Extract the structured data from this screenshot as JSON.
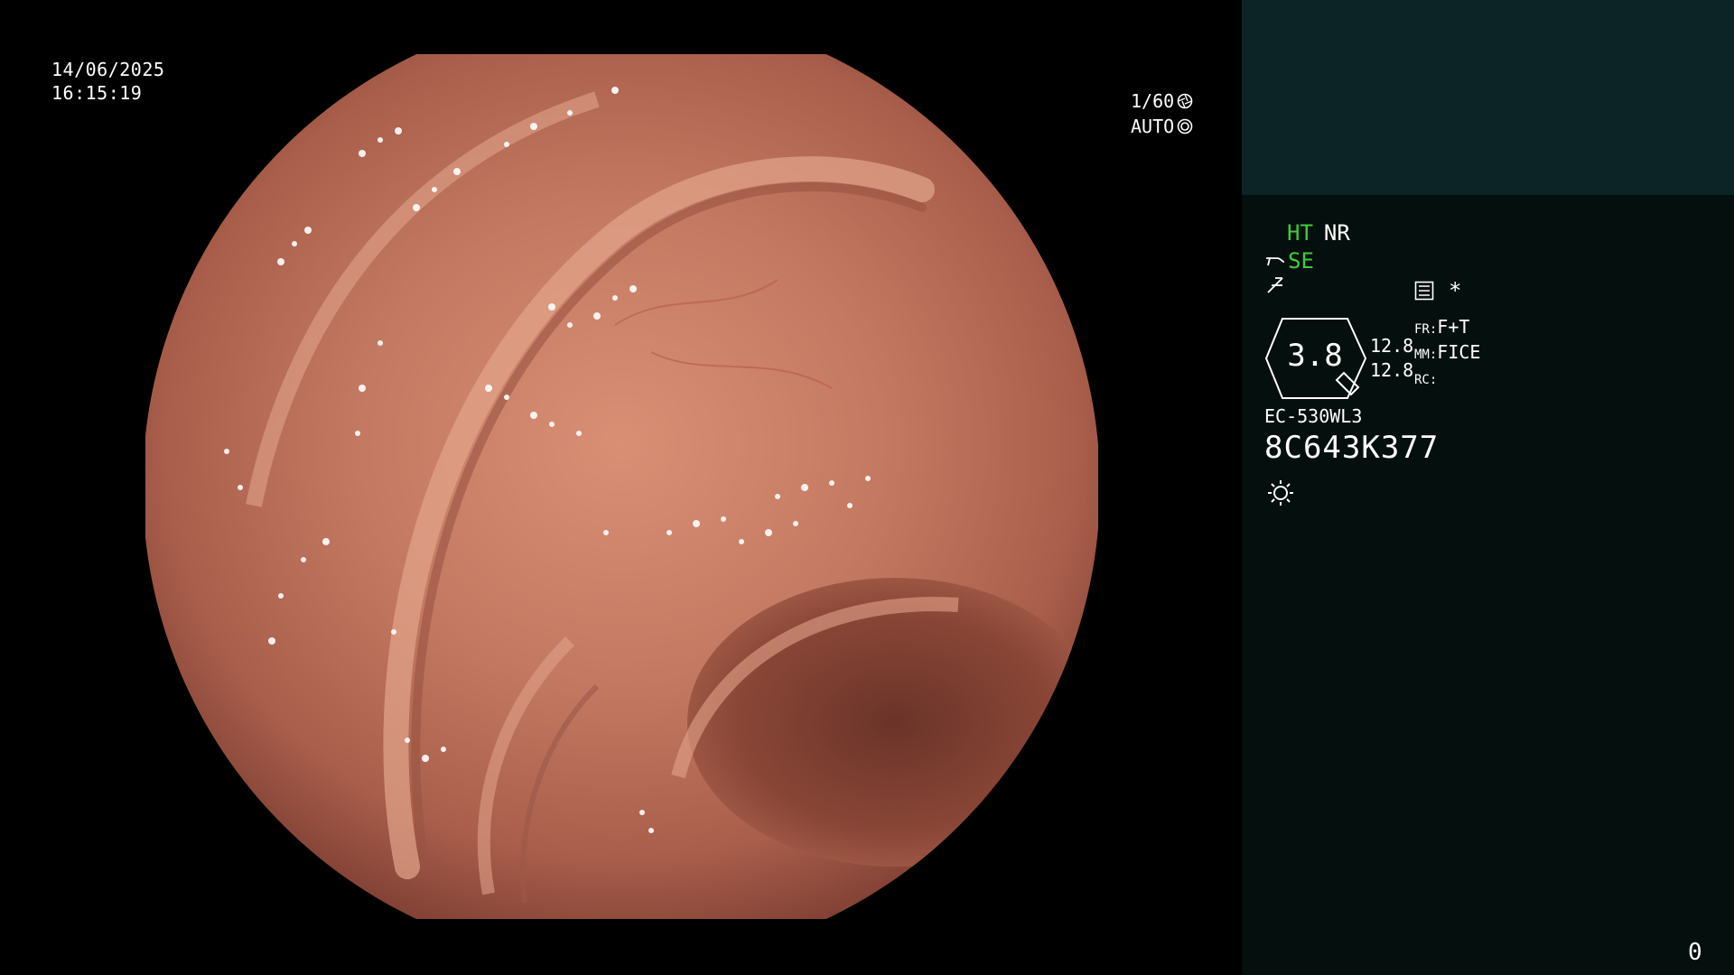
{
  "datetime": {
    "date": "14/06/2025",
    "time": "16:15:19"
  },
  "exposure": {
    "shutter": "1/60",
    "mode": "AUTO",
    "shutter_icon": "aperture-icon",
    "mode_icon": "iris-icon"
  },
  "processing": {
    "ht": "HT",
    "nr": "NR",
    "se": "SE",
    "se_icon": "brightness-curve-icon",
    "enhance_icon": "enhance-curve-icon",
    "menu_icon": "menu-list-icon",
    "star": "*"
  },
  "zoom": {
    "value": "3.8",
    "values": [
      "12.8",
      "12.8"
    ]
  },
  "modes": {
    "fr_label": "FR:",
    "fr_value": "F+T",
    "mm_label": "MM:",
    "mm_value": "FICE",
    "rc_label": "RC:",
    "rc_value": ""
  },
  "scope": {
    "model": "EC-530WL3",
    "serial": "8C643K377"
  },
  "light_icon": "sun-icon",
  "counter": "0",
  "colors": {
    "accent": "#3dcc3d",
    "panel": "#050f0d",
    "panel_top": "#0d2426"
  }
}
